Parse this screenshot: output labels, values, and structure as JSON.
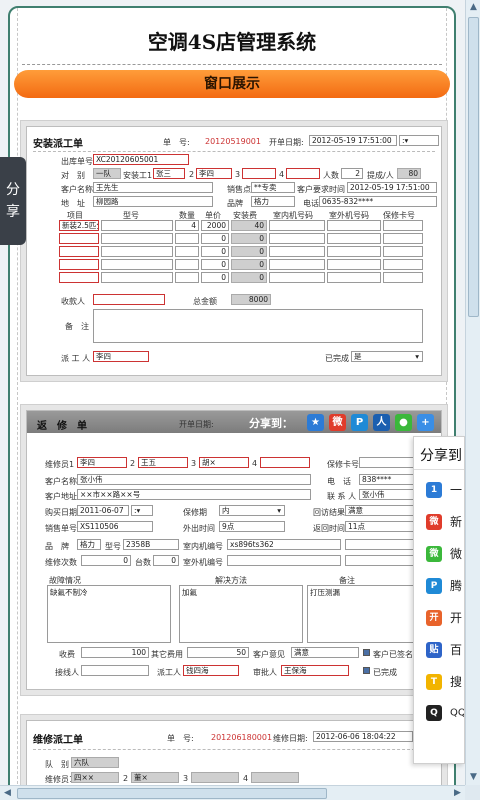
{
  "app": {
    "title": "空调4S店管理系统",
    "banner": "窗口展示"
  },
  "share_tab": {
    "label": "分享"
  },
  "form1": {
    "title": "安装派工单",
    "no_label": "单　号:",
    "no_value": "20120519001",
    "date_label": "开单日期:",
    "date_value": "2012-05-19 17:51:00",
    "outbound_label": "出库单号",
    "outbound_value": "XC20120605001",
    "team_label": "对　别",
    "team_value": "一队",
    "installer1_label": "安装工1",
    "installer1": "张三",
    "n2": "2",
    "installer2": "李四",
    "n3": "3",
    "n4": "4",
    "people_label": "人数",
    "people": "2",
    "commission_label": "提成/人",
    "commission": "80",
    "customer_label": "客户名称",
    "customer": "王先生",
    "sales_point_label": "销售点",
    "sales_point": "**专卖",
    "req_time_label": "客户要求时间",
    "req_time": "2012-05-19 17:51:00",
    "addr_label": "地　址",
    "addr": "柳园路",
    "brand_label": "品牌",
    "brand": "格力",
    "phone_label": "电话",
    "phone": "0635-832****",
    "cols": [
      "项目",
      "型号",
      "数量",
      "单价",
      "安装费",
      "室内机号码",
      "室外机号码",
      "保修卡号"
    ],
    "row1": [
      "新装2.5匹分",
      "",
      "4",
      "2000",
      "40"
    ],
    "zero": "0",
    "collect_label": "收款人",
    "total_label": "总金额",
    "total": "8000",
    "remark_label": "备　注",
    "dispatcher_label": "派 工 人",
    "dispatcher": "李四",
    "done_label": "已完成",
    "done_value": "是"
  },
  "form2": {
    "title": "返　修　单",
    "date_label": "开单日期:",
    "share_label": "分享到：",
    "repair1_label": "维修员1",
    "repair1": "李四",
    "n2": "2",
    "repair2": "王五",
    "n3": "3",
    "repair3": "胡×",
    "n4": "4",
    "warranty_card_label": "保修卡号",
    "customer_label": "客户名称",
    "customer": "张小伟",
    "phone_label": "电　话",
    "phone": "838****",
    "address_label": "客户地址",
    "address": "××市××路××号",
    "contact_label": "联 系 人",
    "contact": "张小伟",
    "buy_date_label": "购买日期",
    "buy_date": "2011-06-07",
    "warranty_label": "保修期",
    "warranty": "内",
    "visit_label": "回访结果",
    "visit": "满意",
    "sale_no_label": "销售单号",
    "sale_no": "XS110506",
    "out_time_label": "外出时间",
    "out_time": "9点",
    "back_time_label": "返回时间",
    "back_time": "11点",
    "brand_label": "品　牌",
    "brand": "格力",
    "model_label": "型号",
    "model": "2358B",
    "indoor_label": "室内机编号",
    "indoor": "xs896ts362",
    "outdoor_label": "室外机编号",
    "times_label": "维修次数",
    "times": "0",
    "units_label": "台数",
    "units": "0",
    "fault_label": "故障情况",
    "fault": "缺氟不制冷",
    "solution_label": "解决方法",
    "solution": "加氟",
    "note_label": "备注",
    "note": "打压测漏",
    "fee_label": "收费",
    "fee": "100",
    "other_fee_label": "其它费用",
    "other_fee": "50",
    "opinion_label": "客户意见",
    "opinion": "满意",
    "signed_label": "客户已签名",
    "receiver_label": "接线人",
    "dispatcher_label": "派工人",
    "dispatcher": "钱四海",
    "approver_label": "审批人",
    "approver": "王保海",
    "done_label": "已完成"
  },
  "form3": {
    "title": "维修派工单",
    "no_label": "单　号:",
    "no_value": "201206180001",
    "date_label": "维修日期:",
    "date_value": "2012-06-06 18:04:22",
    "team_label": "队　别",
    "team": "六队",
    "repair1_label": "维修员1",
    "repair1": "四××",
    "n2": "2",
    "repair2": "董×",
    "n3": "3",
    "n4": "4"
  },
  "share_panel": {
    "title": "分享到",
    "items": [
      {
        "icon": "qzone-icon",
        "label": "一",
        "color": "#2c7bd6",
        "glyph": "1"
      },
      {
        "icon": "weibo-icon",
        "label": "新",
        "color": "#e03c2b",
        "glyph": "微"
      },
      {
        "icon": "wechat-icon",
        "label": "微",
        "color": "#3bb83b",
        "glyph": "微"
      },
      {
        "icon": "tencent-weibo-icon",
        "label": "腾",
        "color": "#1f8ad6",
        "glyph": "P"
      },
      {
        "icon": "kaixin-icon",
        "label": "开",
        "color": "#e8632b",
        "glyph": "开"
      },
      {
        "icon": "baidu-tieba-icon",
        "label": "百",
        "color": "#2e64c8",
        "glyph": "贴"
      },
      {
        "icon": "sohu-icon",
        "label": "搜",
        "color": "#f2b400",
        "glyph": "T"
      },
      {
        "icon": "qq-icon",
        "label": "QQ",
        "color": "#222222",
        "glyph": "Q"
      }
    ]
  }
}
